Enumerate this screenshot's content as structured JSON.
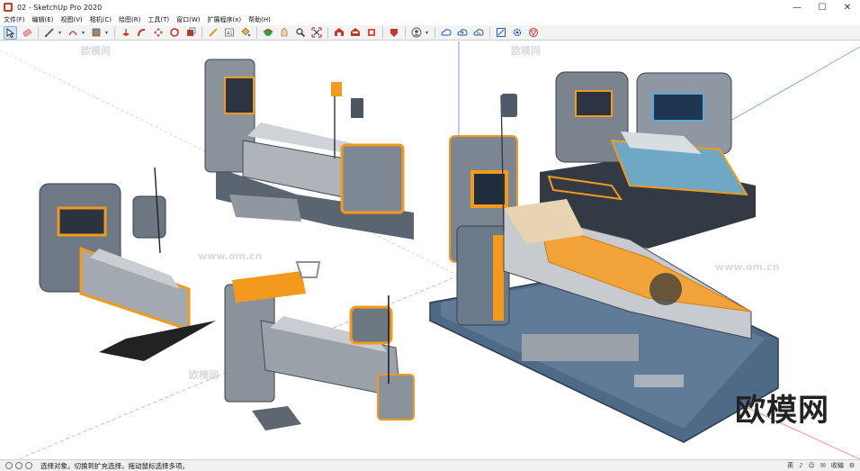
{
  "window": {
    "title": "02 - SketchUp Pro 2020",
    "controls": {
      "minimize": "—",
      "maximize": "☐",
      "close": "✕"
    }
  },
  "menu": {
    "items": [
      "文件(F)",
      "编辑(E)",
      "视图(V)",
      "相机(C)",
      "绘图(R)",
      "工具(T)",
      "窗口(W)",
      "扩展程序(x)",
      "帮助(H)"
    ]
  },
  "toolbar": {
    "tools": [
      {
        "name": "select-tool",
        "active": true
      },
      {
        "name": "eraser-tool"
      },
      {
        "name": "line-tool"
      },
      {
        "name": "arc-tool"
      },
      {
        "name": "rectangle-tool"
      },
      {
        "name": "push-pull-tool"
      },
      {
        "name": "follow-me-tool"
      },
      {
        "name": "move-tool"
      },
      {
        "name": "rotate-tool"
      },
      {
        "name": "scale-tool"
      },
      {
        "name": "tape-measure-tool"
      },
      {
        "name": "text-tool"
      },
      {
        "name": "paint-bucket-tool"
      },
      {
        "name": "orbit-tool"
      },
      {
        "name": "pan-tool"
      },
      {
        "name": "zoom-tool"
      },
      {
        "name": "zoom-extents-tool"
      },
      {
        "name": "warehouse-tool"
      },
      {
        "name": "extension-warehouse-tool"
      },
      {
        "name": "send-to-layout-tool"
      },
      {
        "name": "extension-manager-tool"
      },
      {
        "name": "account-tool"
      },
      {
        "name": "trimble-connect-tool"
      },
      {
        "name": "cloud-upload-tool"
      },
      {
        "name": "cloud-sync-tool"
      },
      {
        "name": "model-info-tool"
      },
      {
        "name": "settings-tool"
      },
      {
        "name": "ar-tool"
      }
    ]
  },
  "viewport": {
    "watermark": "欧模网",
    "small_watermarks": [
      "欧模网",
      "www.om.cn"
    ]
  },
  "status": {
    "text": "选择对象。切换到扩充选择。拖动鼠标选择多项。",
    "tray": [
      "英",
      "♪",
      "☺",
      "✉",
      "收编",
      "⚙"
    ]
  }
}
